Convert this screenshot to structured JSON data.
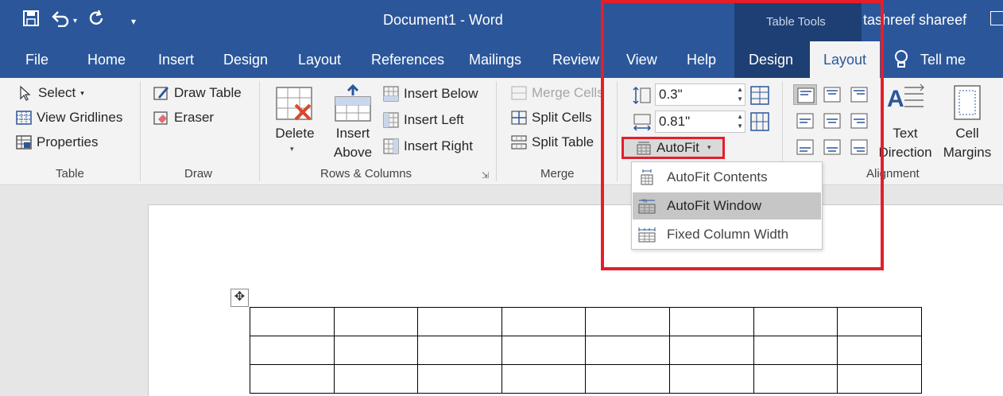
{
  "titlebar": {
    "doc_title": "Document1  -  Word",
    "context_label": "Table Tools",
    "user": "tashreef shareef"
  },
  "tabs": {
    "file": "File",
    "home": "Home",
    "insert": "Insert",
    "design": "Design",
    "layout": "Layout",
    "references": "References",
    "mailings": "Mailings",
    "review": "Review",
    "view": "View",
    "help": "Help",
    "tt_design": "Design",
    "tt_layout": "Layout",
    "tellme": "Tell me"
  },
  "ribbon": {
    "table": {
      "select": "Select",
      "view_gridlines": "View Gridlines",
      "properties": "Properties",
      "label": "Table"
    },
    "draw": {
      "draw_table": "Draw Table",
      "eraser": "Eraser",
      "label": "Draw"
    },
    "rows_cols": {
      "delete": "Delete",
      "insert_above_1": "Insert",
      "insert_above_2": "Above",
      "insert_below": "Insert Below",
      "insert_left": "Insert Left",
      "insert_right": "Insert Right",
      "label": "Rows & Columns"
    },
    "merge": {
      "merge_cells": "Merge Cells",
      "split_cells": "Split Cells",
      "split_table": "Split Table",
      "label": "Merge"
    },
    "cell_size": {
      "height": "0.3\"",
      "width": "0.81\"",
      "autofit": "AutoFit"
    },
    "alignment": {
      "text_dir_1": "Text",
      "text_dir_2": "Direction",
      "cell_margins_1": "Cell",
      "cell_margins_2": "Margins",
      "label": "Alignment"
    }
  },
  "autofit_menu": {
    "contents": "AutoFit Contents",
    "window": "AutoFit Window",
    "fixed": "Fixed Column Width"
  },
  "colors": {
    "word_blue": "#2b579a",
    "highlight_red": "#e61e2a"
  }
}
